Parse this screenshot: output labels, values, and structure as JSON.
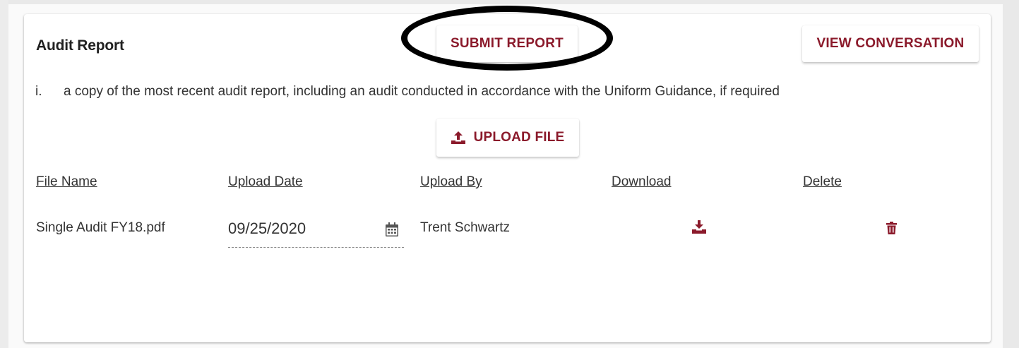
{
  "card": {
    "title": "Audit Report",
    "submit_label": "SUBMIT REPORT",
    "view_conversation_label": "VIEW CONVERSATION",
    "requirement_number": "i.",
    "requirement_text": "a copy of the most recent audit report, including an audit conducted in accordance with the Uniform Guidance, if required",
    "upload_label": "UPLOAD FILE"
  },
  "table": {
    "headers": {
      "file_name": "File Name",
      "upload_date": "Upload Date",
      "upload_by": "Upload By",
      "download": "Download",
      "delete": "Delete"
    },
    "rows": [
      {
        "file_name": "Single Audit FY18.pdf",
        "upload_date": "09/25/2020",
        "upload_by": "Trent Schwartz"
      }
    ]
  },
  "icons": {
    "upload": "upload-icon",
    "calendar": "calendar-icon",
    "download": "download-icon",
    "delete": "trash-icon"
  },
  "colors": {
    "accent": "#8b1a2b",
    "text": "#333333",
    "annotation": "#000000"
  }
}
